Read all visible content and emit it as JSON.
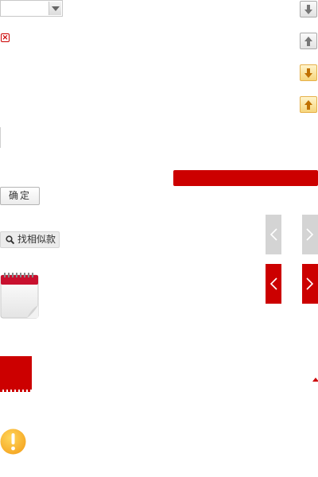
{
  "select": {
    "value": ""
  },
  "buttons": {
    "confirm_label": "确定",
    "find_similar_label": "找相似款"
  },
  "colors": {
    "accent_red": "#cc0000",
    "neutral_grey": "#d4d4d4",
    "highlight_gold": "#f6d57c",
    "warning_orange": "#f5a623"
  },
  "icons": {
    "close": "close-icon",
    "move_down": "arrow-down-icon",
    "move_up": "arrow-up-icon",
    "search": "search-icon",
    "prev": "chevron-left-icon",
    "next": "chevron-right-icon",
    "calendar": "calendar-icon",
    "warning": "warning-icon"
  }
}
